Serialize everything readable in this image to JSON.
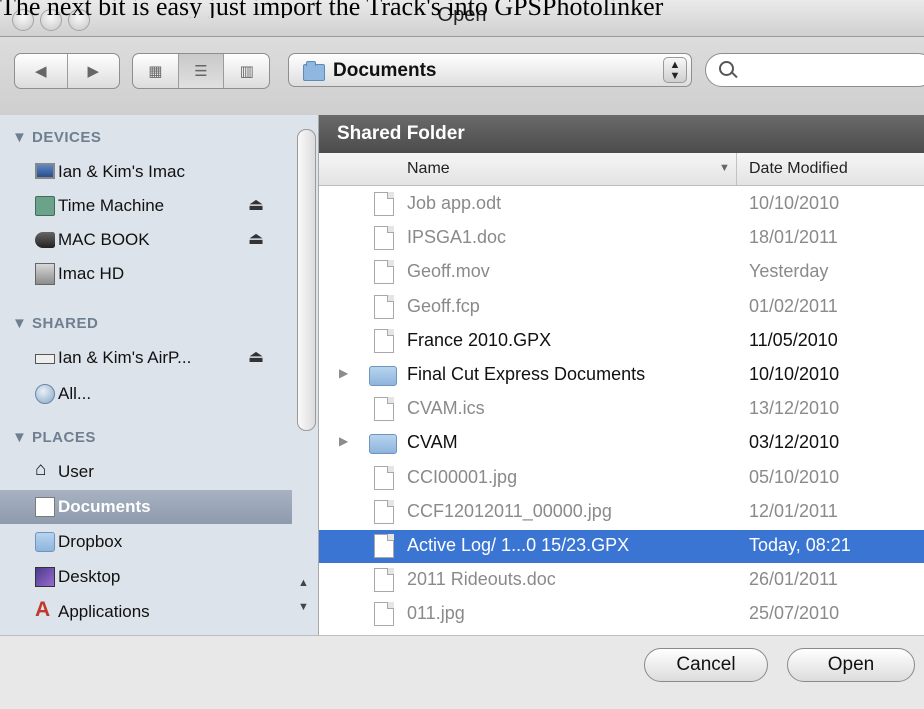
{
  "caption": "The next bit is easy just import the Track's into GPSPhotolinker",
  "window": {
    "title": "Open"
  },
  "toolbar": {
    "location": "Documents",
    "search": {
      "value": "",
      "placeholder": ""
    }
  },
  "sidebar": {
    "sections": [
      {
        "heading": "DEVICES",
        "items": [
          {
            "label": "Ian & Kim's Imac",
            "icon": "imac-icon"
          },
          {
            "label": "Time Machine",
            "icon": "time-machine-icon",
            "eject": true
          },
          {
            "label": "MAC BOOK",
            "icon": "drive-icon",
            "eject": true
          },
          {
            "label": "Imac HD",
            "icon": "hard-drive-icon"
          }
        ]
      },
      {
        "heading": "SHARED",
        "items": [
          {
            "label": "Ian & Kim's AirP...",
            "icon": "airport-icon",
            "eject": true
          },
          {
            "label": "All...",
            "icon": "network-icon"
          }
        ]
      },
      {
        "heading": "PLACES",
        "items": [
          {
            "label": "User",
            "icon": "home-icon"
          },
          {
            "label": "Documents",
            "icon": "documents-folder-icon",
            "selected": true
          },
          {
            "label": "Dropbox",
            "icon": "dropbox-icon"
          },
          {
            "label": "Desktop",
            "icon": "desktop-icon"
          },
          {
            "label": "Applications",
            "icon": "applications-icon"
          }
        ]
      }
    ]
  },
  "list": {
    "heading": "Shared Folder",
    "columns": {
      "name": "Name",
      "date": "Date Modified"
    },
    "rows": [
      {
        "name": "Job app.odt",
        "date": "10/10/2010",
        "kind": "file",
        "dim": true
      },
      {
        "name": "IPSGA1.doc",
        "date": "18/01/2011",
        "kind": "file",
        "dim": true
      },
      {
        "name": "Geoff.mov",
        "date": "Yesterday",
        "kind": "file",
        "dim": true
      },
      {
        "name": "Geoff.fcp",
        "date": "01/02/2011",
        "kind": "file",
        "dim": true
      },
      {
        "name": "France 2010.GPX",
        "date": "11/05/2010",
        "kind": "file",
        "dim": false
      },
      {
        "name": "Final Cut Express Documents",
        "date": "10/10/2010",
        "kind": "folder",
        "dim": false
      },
      {
        "name": "CVAM.ics",
        "date": "13/12/2010",
        "kind": "file",
        "dim": true
      },
      {
        "name": "CVAM",
        "date": "03/12/2010",
        "kind": "folder",
        "dim": false
      },
      {
        "name": "CCI00001.jpg",
        "date": "05/10/2010",
        "kind": "file",
        "dim": true
      },
      {
        "name": "CCF12012011_00000.jpg",
        "date": "12/01/2011",
        "kind": "file",
        "dim": true
      },
      {
        "name": "Active Log/ 1...0 15/23.GPX",
        "date": "Today, 08:21",
        "kind": "file",
        "dim": false,
        "selected": true
      },
      {
        "name": "2011 Rideouts.doc",
        "date": "26/01/2011",
        "kind": "file",
        "dim": true
      },
      {
        "name": "011.jpg",
        "date": "25/07/2010",
        "kind": "file",
        "dim": true
      }
    ]
  },
  "footer": {
    "cancel": "Cancel",
    "open": "Open"
  }
}
